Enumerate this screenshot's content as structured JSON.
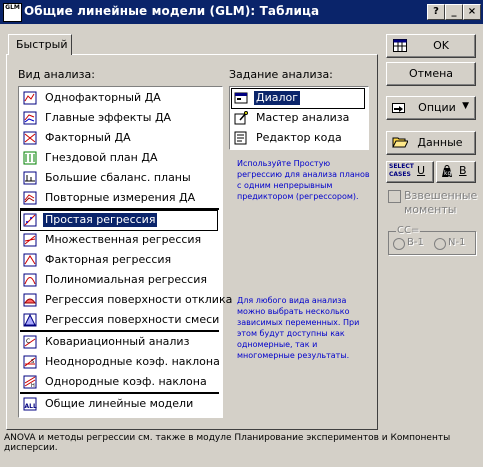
{
  "title": "Общие линейные модели (GLM): Таблица",
  "app_icon_text": "GLM",
  "tab_label": "Быстрый",
  "analysis_type_label": "Вид анализа:",
  "analysis_items": [
    {
      "label": "Однофакторный ДА",
      "icon": "one-way-anova-icon"
    },
    {
      "label": "Главные эффекты ДА",
      "icon": "main-effects-anova-icon"
    },
    {
      "label": "Факторный ДА",
      "icon": "factorial-anova-icon"
    },
    {
      "label": "Гнездовой план ДА",
      "icon": "nested-design-icon"
    },
    {
      "label": "Большие сбаланс. планы",
      "icon": "large-balanced-icon"
    },
    {
      "label": "Повторные измерения ДА",
      "icon": "repeated-measures-icon"
    },
    {
      "label": "Простая регрессия",
      "icon": "simple-regression-icon"
    },
    {
      "label": "Множественная регрессия",
      "icon": "multiple-regression-icon"
    },
    {
      "label": "Факторная регрессия",
      "icon": "factorial-regression-icon"
    },
    {
      "label": "Полиномиальная регрессия",
      "icon": "polynomial-regression-icon"
    },
    {
      "label": "Регрессия поверхности отклика",
      "icon": "response-surface-icon"
    },
    {
      "label": "Регрессия поверхности смеси",
      "icon": "mixture-surface-icon"
    },
    {
      "label": "Ковариационный анализ",
      "icon": "ancova-icon"
    },
    {
      "label": "Неоднородные коэф. наклона",
      "icon": "separate-slopes-icon"
    },
    {
      "label": "Однородные коэф. наклона",
      "icon": "homogeneous-slopes-icon"
    },
    {
      "label": "Общие линейные модели",
      "icon": "all-glm-icon"
    }
  ],
  "selected_item": "Простая регрессия",
  "spec_label": "Задание анализа:",
  "spec_items": [
    {
      "label": "Диалог",
      "icon": "dialog-icon"
    },
    {
      "label": "Мастер анализа",
      "icon": "wizard-icon"
    },
    {
      "label": "Редактор кода",
      "icon": "code-editor-icon"
    }
  ],
  "hint1": "Используйте Простую регрессию для анализа планов с одним непрерывным предиктором (регрессором).",
  "hint2": "Для любого вида анализа можно выбрать несколько зависимых переменных. При этом будут доступны как одномерные, так и многомерные результаты.",
  "buttons": {
    "ok": "OK",
    "cancel": "Отмена",
    "options": "Опции",
    "data": "Данные",
    "select_cases": "SELECT CASES",
    "select_cases_letter": "U",
    "weights_letter": "B",
    "weighted_moments": "Взвешенные моменты",
    "cc_label": "CC=",
    "cc_opt1": "B-1",
    "cc_opt2": "N-1"
  },
  "status_text": "ANOVA и методы регрессии см. также в модуле Планирование экспериментов и Компоненты дисперсии."
}
